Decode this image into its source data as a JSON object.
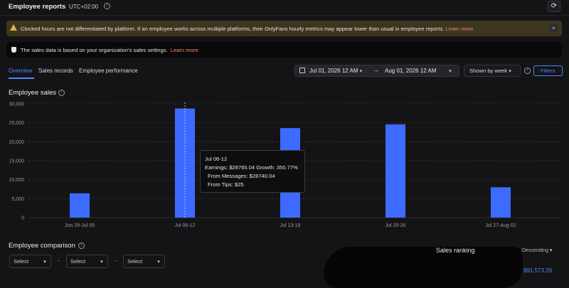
{
  "header": {
    "title": "Employee reports",
    "timezone": "UTC+02:00",
    "refresh_icon": "refresh-icon"
  },
  "warning_banner": {
    "text": "Clocked hours are not differentiated by platform. If an employee works across multiple platforms, their OnlyFans hourly metrics may appear lower than usual in employee reports.",
    "link": "Learn more",
    "icon": "warning-icon",
    "close_glyph": "×"
  },
  "info_banner": {
    "text": "The sales data is based on your organization's sales settings.",
    "link": "Learn more",
    "icon": "shield-icon"
  },
  "tabs": [
    {
      "label": "Overview",
      "active": true
    },
    {
      "label": "Sales records",
      "active": false
    },
    {
      "label": "Employee performance",
      "active": false
    }
  ],
  "date_range": {
    "from": "Jul 01, 2026 12 AM",
    "arrow": "→",
    "to": "Aug 01, 2026 12 AM"
  },
  "grouping": {
    "label": "Shown by week"
  },
  "filters": {
    "label": "Filters"
  },
  "employee_sales": {
    "title": "Employee sales"
  },
  "chart_data": {
    "type": "bar",
    "categories": [
      "Jun 29-Jul 05",
      "Jul 06-12",
      "Jul 13-19",
      "Jul 20-26",
      "Jul 27-Aug 02"
    ],
    "values": [
      6400,
      28765.04,
      23600,
      24600,
      8000
    ],
    "yticks": [
      "0",
      "5,000",
      "10,000",
      "15,000",
      "20,000",
      "25,000",
      "30,000"
    ],
    "ylim": [
      0,
      30000
    ],
    "bar_color": "#3d6bff",
    "hover_index": 1,
    "grid": true
  },
  "tooltip": {
    "title": "Jul 06-12",
    "earnings": "Earnings: $28765.04  Growth: 350.77%",
    "messages": "From Messages: $28740.04",
    "tips": "From Tips: $25"
  },
  "comparison": {
    "title": "Employee comparison",
    "selects": [
      "Select",
      "Select",
      "Select"
    ],
    "separator": "-"
  },
  "ranking": {
    "title": "Sales ranking",
    "sort": "Descending",
    "top_value": "$91,573.26"
  }
}
